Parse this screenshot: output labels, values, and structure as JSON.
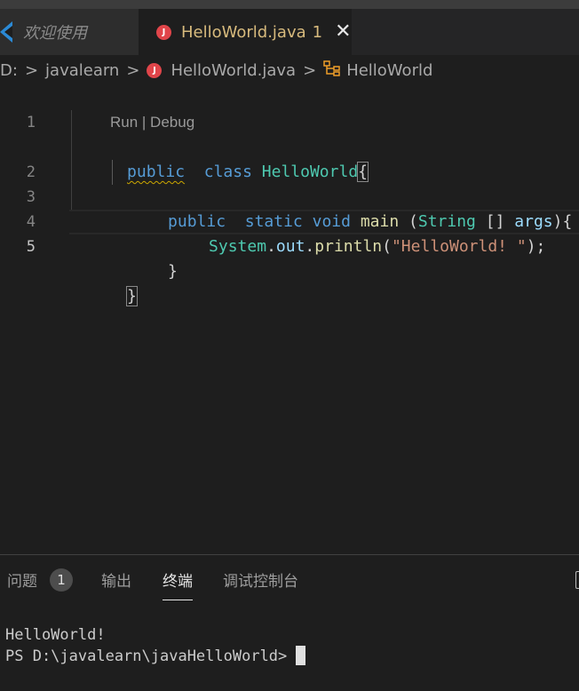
{
  "tabs": {
    "welcome_label": "欢迎使用",
    "active_label": "HelloWorld.java",
    "active_problem_count": "1"
  },
  "breadcrumb": {
    "drive": "D:",
    "folder": "javalearn",
    "file": "HelloWorld.java",
    "symbol": "HelloWorld"
  },
  "editor": {
    "line_numbers": [
      "1",
      "2",
      "3",
      "4",
      "5"
    ],
    "codelens": "Run | Debug",
    "code": {
      "l1_kw1": "public",
      "l1_kw2": "class",
      "l1_name": "HelloWorld",
      "l1_brace": "{",
      "l2_kw1": "public",
      "l2_kw2": "static",
      "l2_kw3": "void",
      "l2_fn": "main",
      "l2_p1": " (",
      "l2_type": "String",
      "l2_p2": " [] ",
      "l2_arg": "args",
      "l2_p3": "){",
      "l3_cls": "System",
      "l3_dot1": ".",
      "l3_field": "out",
      "l3_dot2": ".",
      "l3_fn": "println",
      "l3_p1": "(",
      "l3_str": "\"HelloWorld! \"",
      "l3_p2": ");",
      "l4_brace": "}",
      "l5_brace": "}"
    }
  },
  "panel": {
    "tabs": [
      "问题",
      "输出",
      "终端",
      "调试控制台"
    ],
    "problems_badge": "1",
    "active_tab": "终端"
  },
  "terminal": {
    "output_line": "HelloWorld!",
    "prompt": "PS D:\\javalearn\\javaHelloWorld>"
  },
  "colors": {
    "keyword": "#569cd6",
    "type": "#4ec9b0",
    "function": "#dcdcaa",
    "variable": "#9cdcfe",
    "string": "#ce9178",
    "java_icon": "#e0454a",
    "active_tab_text": "#d7ba7d"
  }
}
